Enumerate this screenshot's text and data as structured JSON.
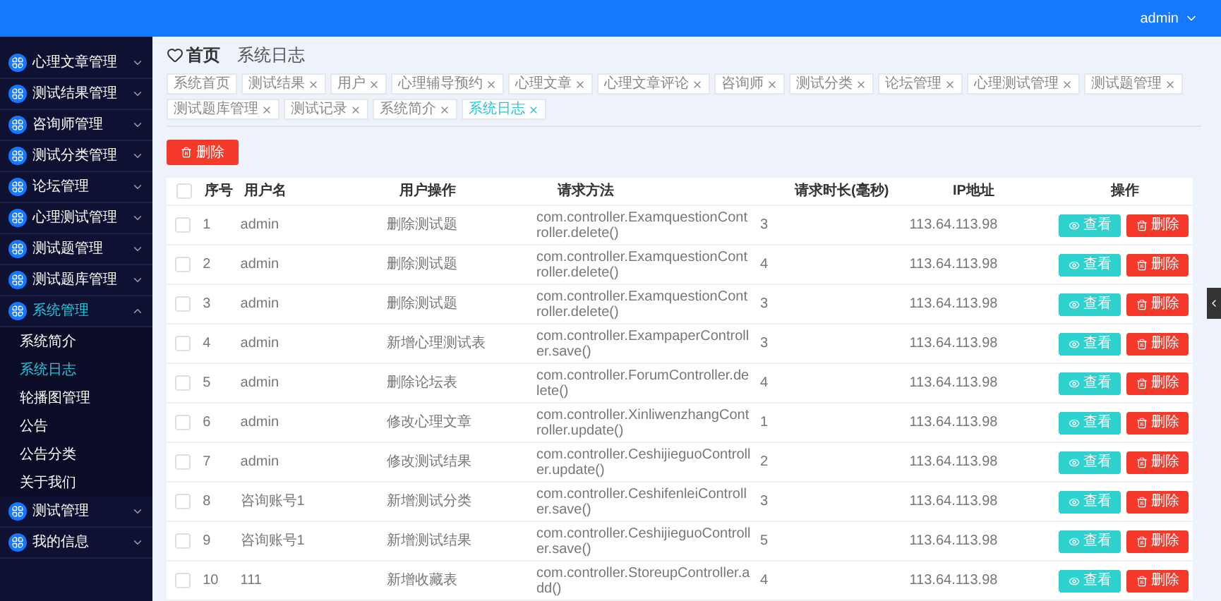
{
  "top_bar": {
    "user": "admin"
  },
  "sidebar": {
    "items": [
      {
        "label": "心理文章管理",
        "expanded": false
      },
      {
        "label": "测试结果管理",
        "expanded": false
      },
      {
        "label": "咨询师管理",
        "expanded": false
      },
      {
        "label": "测试分类管理",
        "expanded": false
      },
      {
        "label": "论坛管理",
        "expanded": false
      },
      {
        "label": "心理测试管理",
        "expanded": false
      },
      {
        "label": "测试题管理",
        "expanded": false
      },
      {
        "label": "测试题库管理",
        "expanded": false
      },
      {
        "label": "系统管理",
        "expanded": true,
        "children": [
          {
            "label": "系统简介",
            "selected": false
          },
          {
            "label": "系统日志",
            "selected": true
          },
          {
            "label": "轮播图管理",
            "selected": false
          },
          {
            "label": "公告",
            "selected": false
          },
          {
            "label": "公告分类",
            "selected": false
          },
          {
            "label": "关于我们",
            "selected": false
          }
        ]
      },
      {
        "label": "测试管理",
        "expanded": false
      },
      {
        "label": "我的信息",
        "expanded": false
      }
    ]
  },
  "breadcrumb": {
    "home": "首页",
    "current": "系统日志"
  },
  "tags": [
    {
      "label": "系统首页",
      "closable": false,
      "selected": false
    },
    {
      "label": "测试结果",
      "closable": true,
      "selected": false
    },
    {
      "label": "用户",
      "closable": true,
      "selected": false
    },
    {
      "label": "心理辅导预约",
      "closable": true,
      "selected": false
    },
    {
      "label": "心理文章",
      "closable": true,
      "selected": false
    },
    {
      "label": "心理文章评论",
      "closable": true,
      "selected": false
    },
    {
      "label": "咨询师",
      "closable": true,
      "selected": false
    },
    {
      "label": "测试分类",
      "closable": true,
      "selected": false
    },
    {
      "label": "论坛管理",
      "closable": true,
      "selected": false
    },
    {
      "label": "心理测试管理",
      "closable": true,
      "selected": false
    },
    {
      "label": "测试题管理",
      "closable": true,
      "selected": false
    },
    {
      "label": "测试题库管理",
      "closable": true,
      "selected": false
    },
    {
      "label": "测试记录",
      "closable": true,
      "selected": false
    },
    {
      "label": "系统简介",
      "closable": true,
      "selected": false
    },
    {
      "label": "系统日志",
      "closable": true,
      "selected": true
    }
  ],
  "delete_button": "删除",
  "table": {
    "all_checked": false,
    "columns": [
      "序号",
      "用户名",
      "用户操作",
      "请求方法",
      "请求时长(毫秒)",
      "IP地址",
      "操作"
    ],
    "rows": [
      {
        "checked": false,
        "cells": [
          "1",
          "admin",
          "删除测试题",
          "com.controller.ExamquestionController.delete()",
          "3",
          "113.64.113.98"
        ],
        "actions": [
          "查看",
          "删除"
        ]
      },
      {
        "checked": false,
        "cells": [
          "2",
          "admin",
          "删除测试题",
          "com.controller.ExamquestionController.delete()",
          "4",
          "113.64.113.98"
        ],
        "actions": [
          "查看",
          "删除"
        ]
      },
      {
        "checked": false,
        "cells": [
          "3",
          "admin",
          "删除测试题",
          "com.controller.ExamquestionController.delete()",
          "3",
          "113.64.113.98"
        ],
        "actions": [
          "查看",
          "删除"
        ]
      },
      {
        "checked": false,
        "cells": [
          "4",
          "admin",
          "新增心理测试表",
          "com.controller.ExampaperController.save()",
          "3",
          "113.64.113.98"
        ],
        "actions": [
          "查看",
          "删除"
        ]
      },
      {
        "checked": false,
        "cells": [
          "5",
          "admin",
          "删除论坛表",
          "com.controller.ForumController.delete()",
          "4",
          "113.64.113.98"
        ],
        "actions": [
          "查看",
          "删除"
        ]
      },
      {
        "checked": false,
        "cells": [
          "6",
          "admin",
          "修改心理文章",
          "com.controller.XinliwenzhangController.update()",
          "1",
          "113.64.113.98"
        ],
        "actions": [
          "查看",
          "删除"
        ]
      },
      {
        "checked": false,
        "cells": [
          "7",
          "admin",
          "修改测试结果",
          "com.controller.CeshijieguoController.update()",
          "2",
          "113.64.113.98"
        ],
        "actions": [
          "查看",
          "删除"
        ]
      },
      {
        "checked": false,
        "cells": [
          "8",
          "咨询账号1",
          "新增测试分类",
          "com.controller.CeshifenleiController.save()",
          "3",
          "113.64.113.98"
        ],
        "actions": [
          "查看",
          "删除"
        ]
      },
      {
        "checked": false,
        "cells": [
          "9",
          "咨询账号1",
          "新增测试结果",
          "com.controller.CeshijieguoController.save()",
          "5",
          "113.64.113.98"
        ],
        "actions": [
          "查看",
          "删除"
        ]
      },
      {
        "checked": false,
        "cells": [
          "10",
          "111",
          "新增收藏表",
          "com.controller.StoreupController.add()",
          "4",
          "113.64.113.98"
        ],
        "actions": [
          "查看",
          "删除"
        ]
      }
    ]
  }
}
